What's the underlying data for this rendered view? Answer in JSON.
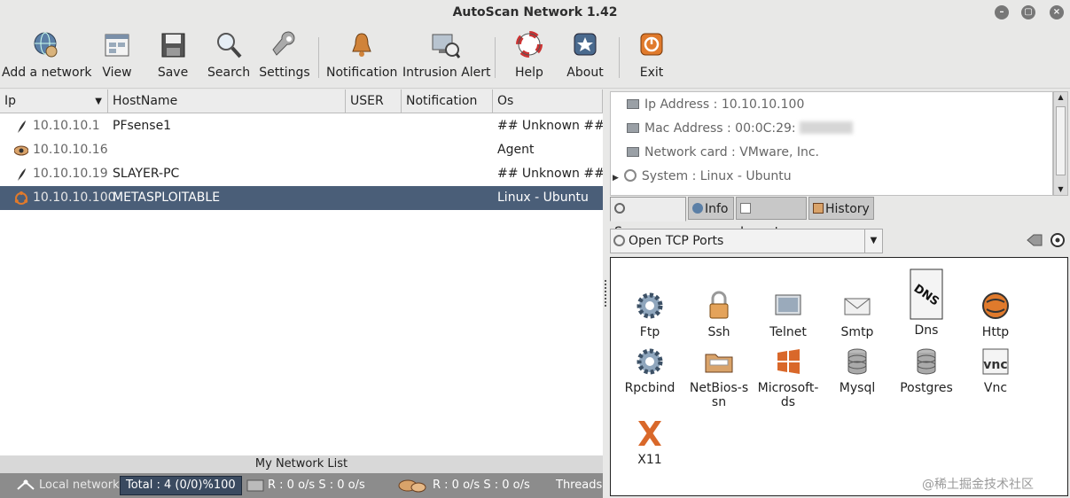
{
  "window": {
    "title": "AutoScan Network 1.42"
  },
  "toolbar": {
    "items": [
      {
        "label": "Add a network",
        "icon": "globe-user-icon"
      },
      {
        "label": "View",
        "icon": "view-icon"
      },
      {
        "label": "Save",
        "icon": "floppy-disk-icon"
      },
      {
        "label": "Search",
        "icon": "magnifier-icon"
      },
      {
        "label": "Settings",
        "icon": "wrench-icon"
      },
      {
        "label": "Notification",
        "icon": "bell-icon"
      },
      {
        "label": "Intrusion Alert",
        "icon": "monitor-alert-icon"
      },
      {
        "label": "Help",
        "icon": "lifebuoy-icon"
      },
      {
        "label": "About",
        "icon": "star-icon"
      },
      {
        "label": "Exit",
        "icon": "exit-icon"
      }
    ]
  },
  "table": {
    "headers": [
      "Ip",
      "HostName",
      "USER",
      "Notification",
      "Os"
    ],
    "rows": [
      {
        "ip": "10.10.10.1",
        "host": "PFsense1",
        "user": "",
        "notification": "",
        "os": "## Unknown ##",
        "icon": "feather-icon",
        "selected": false
      },
      {
        "ip": "10.10.10.16",
        "host": "",
        "user": "",
        "notification": "",
        "os": "Agent",
        "icon": "eye-icon",
        "selected": false
      },
      {
        "ip": "10.10.10.19",
        "host": "SLAYER-PC",
        "user": "",
        "notification": "",
        "os": "## Unknown ##",
        "icon": "feather-icon",
        "selected": false
      },
      {
        "ip": "10.10.10.100",
        "host": "METASPLOITABLE",
        "user": "",
        "notification": "",
        "os": "Linux - Ubuntu",
        "icon": "ubuntu-icon",
        "selected": true
      }
    ],
    "footer": "My Network List"
  },
  "status": {
    "network": "Local network",
    "total": "Total : 4  (0/0)%100",
    "rate1": "R : 0 o/s S : 0 o/s",
    "rate2": "R : 0 o/s S : 0 o/s",
    "threads": "Threads"
  },
  "details": {
    "lines": [
      "Ip Address : 10.10.10.100",
      "Mac Address : 00:0C:29:",
      "Network card : VMware, Inc.",
      "System : Linux - Ubuntu"
    ]
  },
  "tabs": [
    "Summary",
    "Info",
    "Inventory",
    "History"
  ],
  "ports_combo": {
    "value": "Open TCP Ports"
  },
  "ports": [
    {
      "name": "Ftp",
      "icon": "gear-icon"
    },
    {
      "name": "Ssh",
      "icon": "padlock-icon"
    },
    {
      "name": "Telnet",
      "icon": "terminal-icon"
    },
    {
      "name": "Smtp",
      "icon": "envelope-icon"
    },
    {
      "name": "Dns",
      "icon": "dns-icon"
    },
    {
      "name": "Http",
      "icon": "globe-icon"
    },
    {
      "name": "Rpcbind",
      "icon": "gear-icon"
    },
    {
      "name": "NetBios-ssn",
      "icon": "folder-icon"
    },
    {
      "name": "Microsoft-ds",
      "icon": "windows-icon"
    },
    {
      "name": "Mysql",
      "icon": "database-icon"
    },
    {
      "name": "Postgres",
      "icon": "database-icon"
    },
    {
      "name": "Vnc",
      "icon": "vnc-icon"
    },
    {
      "name": "X11",
      "icon": "x11-icon"
    }
  ],
  "watermark": "@稀土掘金技术社区"
}
